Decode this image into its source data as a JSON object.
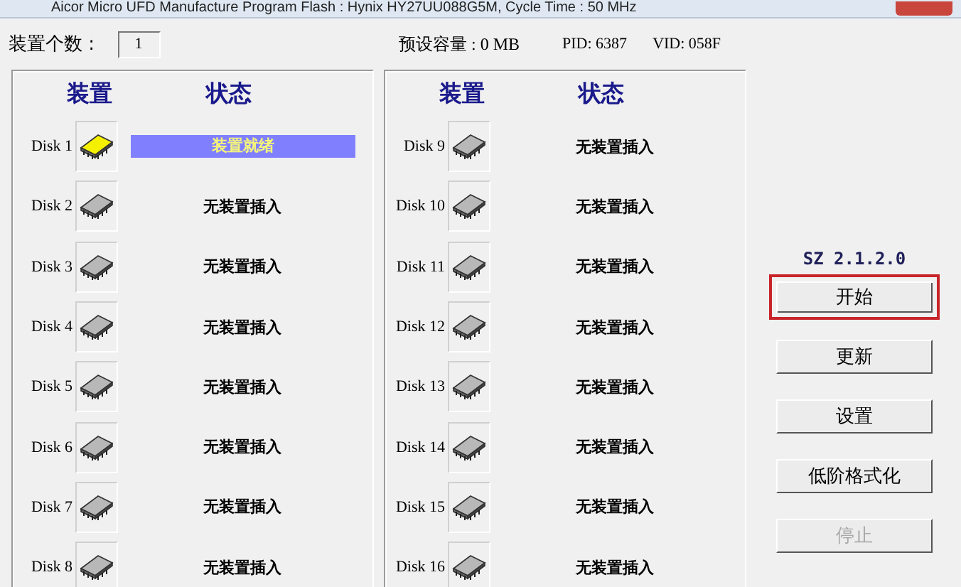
{
  "window": {
    "title": "Aicor Micro UFD Manufacture Program Flash : Hynix HY27UU088G5M, Cycle Time : 50 MHz"
  },
  "info": {
    "count_label": "装置个数 :",
    "count": "1",
    "capacity": "预设容量 : 0 MB",
    "pid": "PID: 6387",
    "vid": "VID: 058F"
  },
  "panels": [
    {
      "headers": [
        "装置",
        "状态"
      ],
      "disks": [
        {
          "label": "Disk 1",
          "kind": "ready",
          "status": "装置就绪"
        },
        {
          "label": "Disk 2",
          "kind": "empty",
          "status": "无装置插入"
        },
        {
          "label": "Disk 3",
          "kind": "empty",
          "status": "无装置插入"
        },
        {
          "label": "Disk 4",
          "kind": "empty",
          "status": "无装置插入"
        },
        {
          "label": "Disk 5",
          "kind": "empty",
          "status": "无装置插入"
        },
        {
          "label": "Disk 6",
          "kind": "empty",
          "status": "无装置插入"
        },
        {
          "label": "Disk 7",
          "kind": "empty",
          "status": "无装置插入"
        },
        {
          "label": "Disk 8",
          "kind": "empty",
          "status": "无装置插入"
        }
      ]
    },
    {
      "headers": [
        "装置",
        "状态"
      ],
      "disks": [
        {
          "label": "Disk 9",
          "kind": "empty",
          "status": "无装置插入"
        },
        {
          "label": "Disk 10",
          "kind": "empty",
          "status": "无装置插入"
        },
        {
          "label": "Disk 11",
          "kind": "empty",
          "status": "无装置插入"
        },
        {
          "label": "Disk 12",
          "kind": "empty",
          "status": "无装置插入"
        },
        {
          "label": "Disk 13",
          "kind": "empty",
          "status": "无装置插入"
        },
        {
          "label": "Disk 14",
          "kind": "empty",
          "status": "无装置插入"
        },
        {
          "label": "Disk 15",
          "kind": "empty",
          "status": "无装置插入"
        },
        {
          "label": "Disk 16",
          "kind": "empty",
          "status": "无装置插入"
        }
      ]
    }
  ],
  "version": "SZ 2.1.2.0",
  "buttons": [
    {
      "label": "开始",
      "highlighted": true,
      "disabled": false
    },
    {
      "label": "更新",
      "highlighted": false,
      "disabled": false
    },
    {
      "label": "设置",
      "highlighted": false,
      "disabled": false
    },
    {
      "label": "低阶格式化",
      "highlighted": false,
      "disabled": false
    },
    {
      "label": "停止",
      "highlighted": false,
      "disabled": true
    }
  ]
}
